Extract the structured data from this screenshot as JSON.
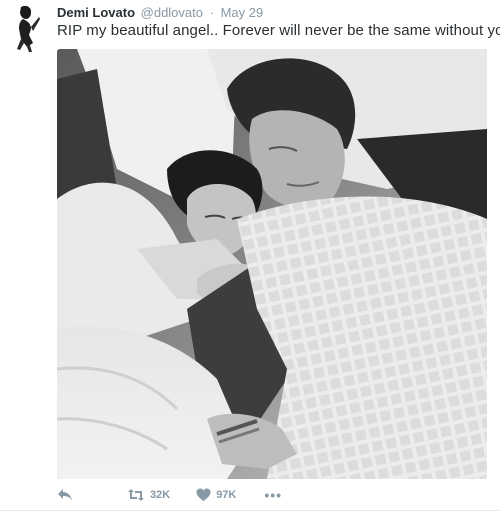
{
  "tweet": {
    "author": {
      "display_name": "Demi Lovato",
      "handle": "@ddlovato",
      "avatar_icon": "profile-photo-icon"
    },
    "separator": "·",
    "timestamp": "May 29",
    "text": "RIP my beautiful angel.. Forever will never be the same without you.",
    "media": {
      "kind": "photo",
      "tone": "black-and-white"
    },
    "actions": {
      "reply_icon": "reply-icon",
      "retweet_icon": "retweet-icon",
      "retweet_count": "32K",
      "like_icon": "heart-icon",
      "like_count": "97K",
      "more_label": "•••"
    }
  },
  "colors": {
    "text": "#292f33",
    "muted": "#8899a6",
    "divider": "#e1e8ed"
  }
}
